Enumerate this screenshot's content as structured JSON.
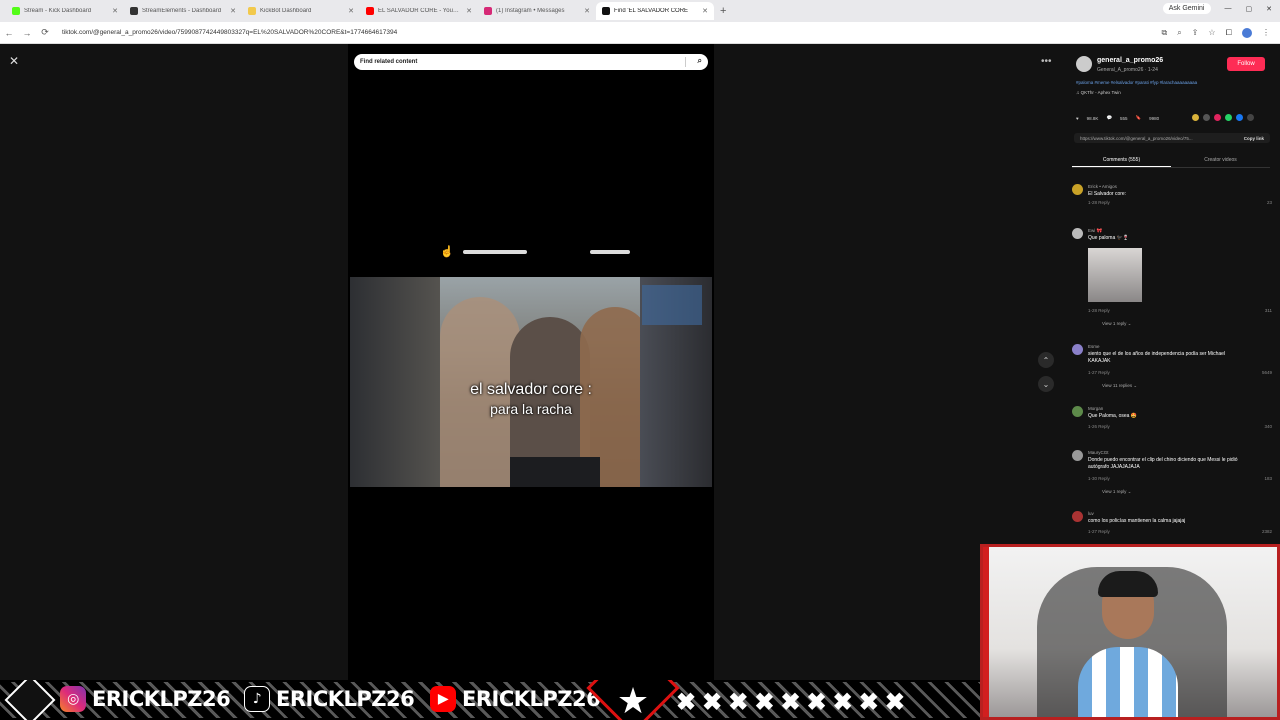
{
  "browser": {
    "tabs": [
      {
        "label": "Stream - Kick Dashboard",
        "color": "#53fc18"
      },
      {
        "label": "StreamElements - Dashboard",
        "color": "#333333"
      },
      {
        "label": "KickBot Dashboard",
        "color": "#f2c94c"
      },
      {
        "label": "EL SALVADOR CORE - YouTube",
        "color": "#ff0000"
      },
      {
        "label": "(1) Instagram • Messages",
        "color": "#d62976"
      },
      {
        "label": "Find 'EL SALVADOR CORE",
        "color": "#111111"
      }
    ],
    "ask_gemini": "Ask Gemini",
    "url": "tiktok.com/@general_a_promo26/video/7599087742449803327q=EL%20SALVADOR%20CORE&t=1774664617394"
  },
  "player": {
    "search_placeholder": "Find related content",
    "caption_line1": "el salvador core :",
    "caption_line2": "para la racha"
  },
  "panel": {
    "username": "general_a_promo26",
    "subtitle": "General_A_promo26 · 1-24",
    "follow_label": "Follow",
    "hashtags": "#paloma #meme #elsalvador #parati #fyp #larachaaaaaaaaa",
    "music": "♫ QKThr - Aphex Twin",
    "likes": "98.8K",
    "comments_count": "555",
    "saves": "9980",
    "link": "https://www.tiktok.com/@general_a_promo26/video/75...",
    "copy_link": "Copy link",
    "tab_comments": "Comments (555)",
    "tab_creator": "Creator videos"
  },
  "comments": [
    {
      "name": "Erick • Amigos",
      "text": "El Salvador core:",
      "meta": "1-28   Reply",
      "likes": "23"
    },
    {
      "name": "Ewi 🎀",
      "text": "Que paloma 🐦‍⬛🍷",
      "meta": "1-28   Reply",
      "likes": "311",
      "replies": "View 1 reply ⌄"
    },
    {
      "name": "Esme",
      "text": "siento que el de los años de independencia podía ser Michael KAKAJAK",
      "meta": "1-27   Reply",
      "likes": "5649",
      "replies": "View 11 replies ⌄"
    },
    {
      "name": "Morgan",
      "text": "Que Paloma, osea 🤩",
      "meta": "1-26   Reply",
      "likes": "340"
    },
    {
      "name": "MauryCGt",
      "text": "Donde puedo encontrar el clip del chino diciendo que Messi le pidió autógrafo JAJAJAJAJA",
      "meta": "1-30   Reply",
      "likes": "183",
      "replies": "View 1 reply ⌄"
    },
    {
      "name": "luv",
      "text": "como los policías mantienen la calma jajajaj",
      "meta": "1-27   Reply",
      "likes": "2382"
    }
  ],
  "banner": {
    "instagram": "ERICKLPZ26",
    "tiktok": "ERICKLPZ26",
    "youtube": "ERICKLPZ26",
    "star": "★",
    "xs": "✖✖✖✖✖✖✖✖✖"
  }
}
